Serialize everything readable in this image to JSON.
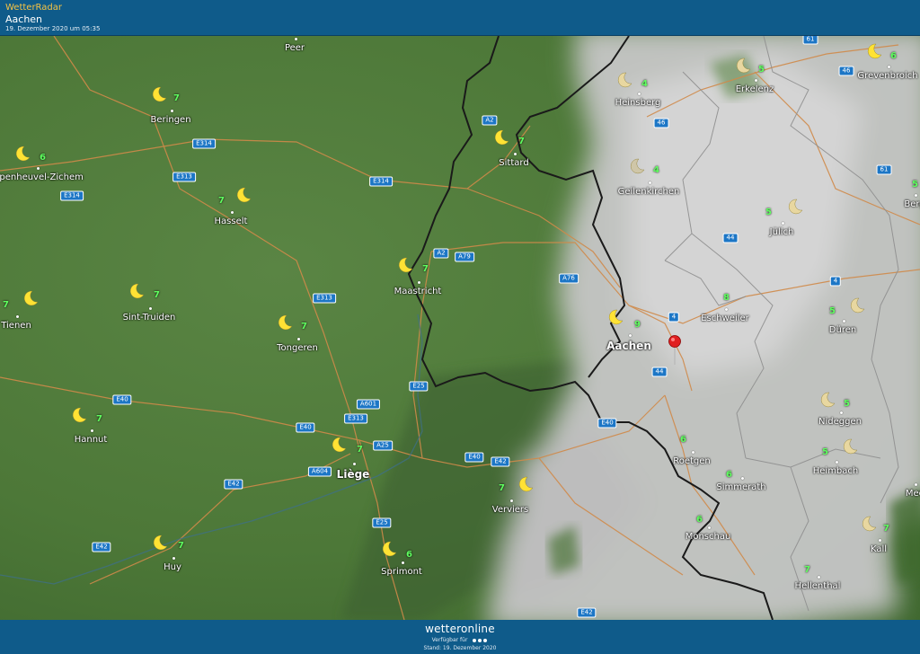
{
  "header": {
    "app_name": "WetterRadar",
    "location": "Aachen",
    "timestamp": "19. Dezember 2020 um 05:35"
  },
  "map": {
    "weather_icon": "moon-icon",
    "pin_icon": "location-pin-icon",
    "colors": {
      "land": "#4f7a3a",
      "cloud": "#c8c8c8",
      "temp": "#5fff5f",
      "road_shield": "#1c76c6",
      "border": "#1a1a1a"
    },
    "cities": [
      {
        "name": "Peer",
        "temp": ""
      },
      {
        "name": "Beringen",
        "temp": "7"
      },
      {
        "name": "erpenheuvel-Zichem",
        "temp": "6"
      },
      {
        "name": "Hasselt",
        "temp": "7"
      },
      {
        "name": "Sittard",
        "temp": "7"
      },
      {
        "name": "Heinsberg",
        "temp": "4"
      },
      {
        "name": "Erkelenz",
        "temp": "5"
      },
      {
        "name": "Grevenbroich",
        "temp": "6"
      },
      {
        "name": "Geilenkirchen",
        "temp": "4"
      },
      {
        "name": "Jülich",
        "temp": "5"
      },
      {
        "name": "Berg",
        "temp": "5"
      },
      {
        "name": "Maastricht",
        "temp": "7"
      },
      {
        "name": "Tienen",
        "temp": "7"
      },
      {
        "name": "Sint-Truiden",
        "temp": "7"
      },
      {
        "name": "Tongeren",
        "temp": "7"
      },
      {
        "name": "Aachen",
        "temp": "9"
      },
      {
        "name": "Eschweiler",
        "temp": "8"
      },
      {
        "name": "Düren",
        "temp": "5"
      },
      {
        "name": "Hannut",
        "temp": "7"
      },
      {
        "name": "Liège",
        "temp": "7"
      },
      {
        "name": "Nideggen",
        "temp": "5"
      },
      {
        "name": "Roetgen",
        "temp": "6"
      },
      {
        "name": "Verviers",
        "temp": "7"
      },
      {
        "name": "Heimbach",
        "temp": "5"
      },
      {
        "name": "Simmerath",
        "temp": "6"
      },
      {
        "name": "Mec",
        "temp": ""
      },
      {
        "name": "Monschau",
        "temp": "6"
      },
      {
        "name": "Kall",
        "temp": "7"
      },
      {
        "name": "Huy",
        "temp": "7"
      },
      {
        "name": "Sprimont",
        "temp": "6"
      },
      {
        "name": "Hellenthal",
        "temp": "7"
      }
    ],
    "roads": [
      "61",
      "46",
      "46",
      "A2",
      "E314",
      "E313",
      "E314",
      "E314",
      "61",
      "A2",
      "A79",
      "A76",
      "44",
      "4",
      "E313",
      "4",
      "44",
      "E25",
      "E40",
      "A601",
      "E40",
      "E313",
      "A25",
      "E40",
      "E40",
      "E42",
      "A604",
      "E42",
      "E25",
      "E42",
      "E42"
    ]
  },
  "footer": {
    "brand": "wetteronline",
    "availability": "Verfügbar für",
    "stand": "Stand: 19. Dezember 2020"
  }
}
